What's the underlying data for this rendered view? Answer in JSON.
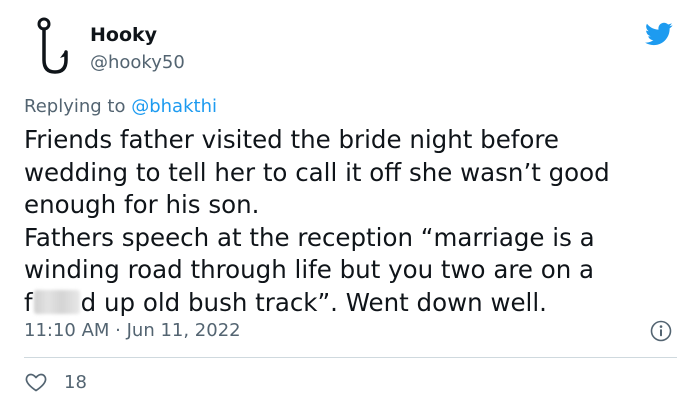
{
  "author": {
    "name": "Hooky",
    "handle": "@hooky50",
    "avatar_icon": "fish-hook-icon"
  },
  "platform_icon": "twitter-bird-icon",
  "reply": {
    "prefix": "Replying to",
    "mention": "@bhakthi"
  },
  "text": {
    "line1": "Friends father visited the bride night before",
    "line2": "wedding to tell her to call it off she wasn’t good",
    "line3": "enough for his son.",
    "line4": "Fathers speech at the reception “marriage is a",
    "line5": "winding road through life but you two are on a",
    "line6_start": "f",
    "line6_end": "d up old bush track”. Went down well."
  },
  "meta": {
    "timestamp": "11:10 AM · Jun 11, 2022",
    "info_icon": "info-icon"
  },
  "actions": {
    "like_icon": "heart-icon",
    "like_count": "18"
  },
  "colors": {
    "text_primary": "#0f1419",
    "text_secondary": "#536471",
    "accent": "#1d9bf0",
    "divider": "#cfd9de"
  }
}
